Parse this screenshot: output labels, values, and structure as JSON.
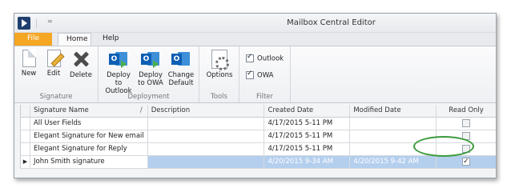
{
  "window": {
    "title": "Mailbox Central Editor",
    "qa_dropdown": "="
  },
  "tabs": [
    {
      "label": "File"
    },
    {
      "label": "Home"
    },
    {
      "label": "Help"
    }
  ],
  "ribbon": {
    "signature": {
      "label": "Signature",
      "new": "New",
      "edit": "Edit",
      "delete": "Delete"
    },
    "deployment": {
      "label": "Deployment",
      "deploy_outlook": [
        "Deploy to",
        "Outlook"
      ],
      "deploy_owa": [
        "Deploy",
        "to OWA"
      ],
      "change_default": [
        "Change",
        "Default"
      ],
      "outlook_letter": "O"
    },
    "tools": {
      "label": "Tools",
      "options": "Options"
    },
    "filter": {
      "label": "Filter",
      "outlook": "Outlook",
      "owa": "OWA",
      "outlook_checked": true,
      "owa_checked": true
    }
  },
  "grid": {
    "columns": {
      "name": "Signature Name",
      "sort_mark": "/",
      "description": "Description",
      "created": "Created Date",
      "modified": "Modified Date",
      "read_only": "Read Only"
    },
    "rows": [
      {
        "name": "All User Fields",
        "description": "",
        "created": "4/17/2015 5-11 PM",
        "modified": "",
        "read_only": false
      },
      {
        "name": "Elegant Signature for New email",
        "description": "",
        "created": "4/17/2015 5-11 PM",
        "modified": "",
        "read_only": false
      },
      {
        "name": "Elegant Signature for Reply",
        "description": "",
        "created": "4/17/2015 5-11 PM",
        "modified": "",
        "read_only": false
      },
      {
        "name": "John Smith signature",
        "description": "",
        "created": "4/20/2015 9-34 AM",
        "modified": "4/20/2015 9-42 AM",
        "read_only": true,
        "indicator": "▶"
      }
    ]
  },
  "colors": {
    "file_tab": "#f5a623",
    "selection": "#b4cfee",
    "highlight": "#3a9a3a"
  }
}
